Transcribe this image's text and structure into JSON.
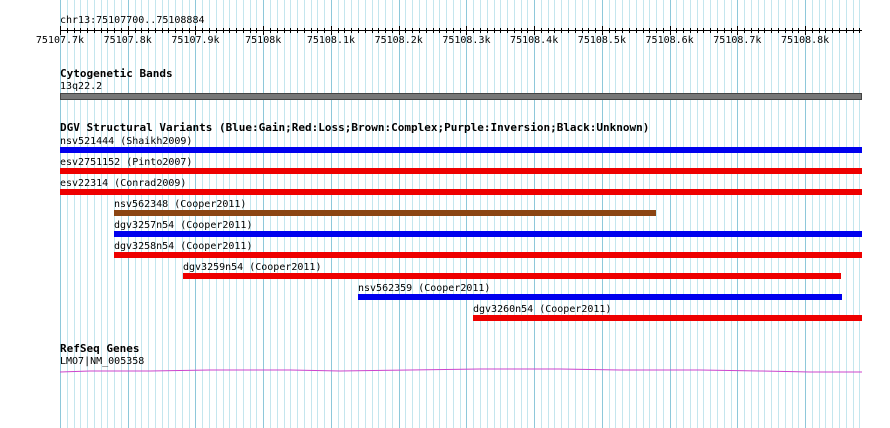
{
  "ruler": {
    "location": "chr13:75107700..75108884",
    "start": 75107700,
    "end": 75108884,
    "ticks": [
      {
        "pos": 75107700,
        "label": "75107.7k"
      },
      {
        "pos": 75107800,
        "label": "75107.8k"
      },
      {
        "pos": 75107900,
        "label": "75107.9k"
      },
      {
        "pos": 75108000,
        "label": "75108k"
      },
      {
        "pos": 75108100,
        "label": "75108.1k"
      },
      {
        "pos": 75108200,
        "label": "75108.2k"
      },
      {
        "pos": 75108300,
        "label": "75108.3k"
      },
      {
        "pos": 75108400,
        "label": "75108.4k"
      },
      {
        "pos": 75108500,
        "label": "75108.5k"
      },
      {
        "pos": 75108600,
        "label": "75108.6k"
      },
      {
        "pos": 75108700,
        "label": "75108.7k"
      },
      {
        "pos": 75108800,
        "label": "75108.8k"
      }
    ]
  },
  "cytoband": {
    "title": "Cytogenetic Bands",
    "band": "13q22.2",
    "color": "#777777"
  },
  "dgv": {
    "title": "DGV Structural Variants (Blue:Gain;Red:Loss;Brown:Complex;Purple:Inversion;Black:Unknown)",
    "colors": {
      "gain": "#0000ee",
      "loss": "#ee0000",
      "complex": "#8b4513",
      "inversion": "#800080",
      "unknown": "#000000"
    },
    "variants": [
      {
        "label": "nsv521444 (Shaikh2009)",
        "type": "gain",
        "start": 75107700,
        "end": 75108884
      },
      {
        "label": "esv2751152 (Pinto2007)",
        "type": "loss",
        "start": 75107700,
        "end": 75108884
      },
      {
        "label": "esv22314 (Conrad2009)",
        "type": "loss",
        "start": 75107700,
        "end": 75108884
      },
      {
        "label": "nsv562348 (Cooper2011)",
        "type": "complex",
        "start": 75107780,
        "end": 75108580
      },
      {
        "label": "dgv3257n54 (Cooper2011)",
        "type": "gain",
        "start": 75107780,
        "end": 75108884
      },
      {
        "label": "dgv3258n54 (Cooper2011)",
        "type": "loss",
        "start": 75107780,
        "end": 75108884
      },
      {
        "label": "dgv3259n54 (Cooper2011)",
        "type": "loss",
        "start": 75107882,
        "end": 75108854
      },
      {
        "label": "nsv562359 (Cooper2011)",
        "type": "gain",
        "start": 75108140,
        "end": 75108854
      },
      {
        "label": "dgv3260n54 (Cooper2011)",
        "type": "loss",
        "start": 75108310,
        "end": 75108884
      }
    ]
  },
  "refseq": {
    "title": "RefSeq Genes",
    "gene": "LMO7|NM_005358",
    "color": "#cc44cc"
  }
}
